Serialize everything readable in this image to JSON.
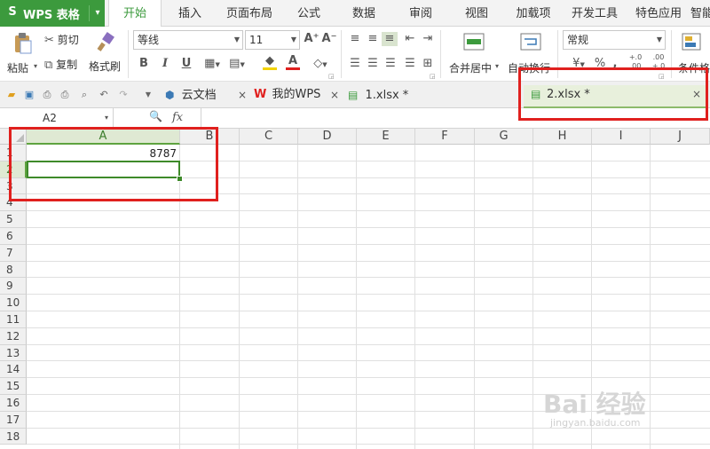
{
  "app": {
    "logo": "S",
    "title": "WPS 表格",
    "dropdown": "▾"
  },
  "menu_tabs": [
    "开始",
    "插入",
    "页面布局",
    "公式",
    "数据",
    "审阅",
    "视图",
    "加载项",
    "开发工具",
    "特色应用",
    "智能"
  ],
  "ribbon": {
    "paste": "粘贴",
    "cut": "剪切",
    "copy": "复制",
    "format_painter": "格式刷",
    "font_name": "等线",
    "font_size": "11",
    "font_grow": "A⁺",
    "font_shrink": "A⁻",
    "bold": "B",
    "italic": "I",
    "underline": "U",
    "merge_center": "合并居中",
    "wrap_text": "自动换行",
    "number_format": "常规",
    "percent": "%",
    "comma": ",",
    "inc_decimal": "+.0 .00",
    "dec_decimal": ".00 +.0",
    "conditional_format": "条件格"
  },
  "doc_tabs": [
    {
      "label": "云文档",
      "icon": "cloud-icon"
    },
    {
      "label": "我的WPS",
      "icon": "wps-logo-icon"
    },
    {
      "label": "1.xlsx *",
      "icon": "spreadsheet-file-icon"
    },
    {
      "label": "2.xlsx *",
      "icon": "spreadsheet-file-icon",
      "active": true
    }
  ],
  "close_symbol": "×",
  "formula_bar": {
    "name_box": "A2",
    "zoom_icon": "🔍",
    "fx": "fx",
    "value": ""
  },
  "columns": [
    "A",
    "B",
    "C",
    "D",
    "E",
    "F",
    "G",
    "H",
    "I",
    "J"
  ],
  "rows": [
    "1",
    "2",
    "3",
    "4",
    "5",
    "6",
    "7",
    "8",
    "9",
    "10",
    "11",
    "12",
    "13",
    "14",
    "15",
    "16",
    "17",
    "18"
  ],
  "cells": {
    "A1": "8787"
  },
  "selected_cell": "A2",
  "accent_color": "#3c9a3d",
  "highlight_color": "#e0201e",
  "watermark": {
    "brand": "Bai 经验",
    "url": "jingyan.baidu.com"
  }
}
